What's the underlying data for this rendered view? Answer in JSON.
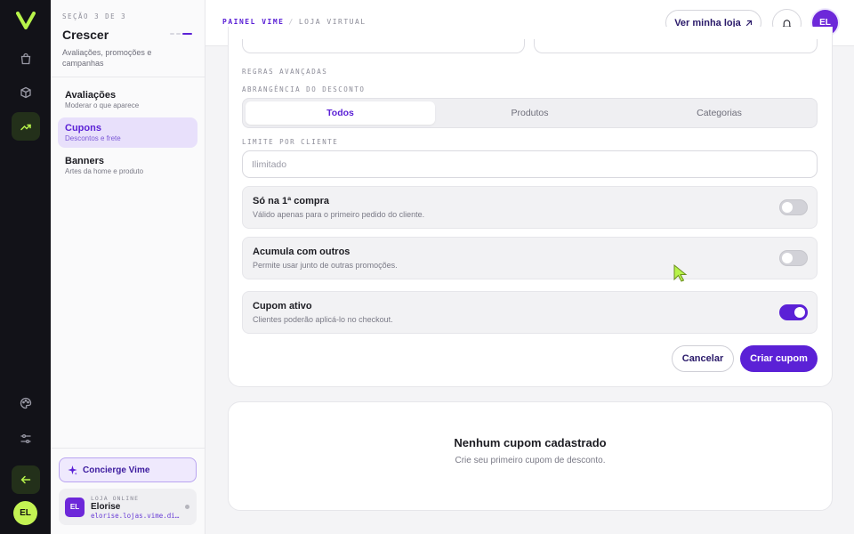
{
  "rail": {
    "avatar": "EL",
    "colors": {
      "bg": "#121218",
      "accent": "#b7f34a"
    }
  },
  "sidebar": {
    "step": "SEÇÃO 3 DE 3",
    "title": "Crescer",
    "description": "Avaliações, promoções e campanhas",
    "items": [
      {
        "label": "Avaliações",
        "sub": "Moderar o que aparece"
      },
      {
        "label": "Cupons",
        "sub": "Descontos e frete"
      },
      {
        "label": "Banners",
        "sub": "Artes da home e produto"
      }
    ],
    "concierge": "Concierge Vime",
    "store": {
      "avatar": "EL",
      "meta": "LOJA ONLINE",
      "name": "Elorise",
      "url": "elorise.lojas.vime.di…"
    }
  },
  "topbar": {
    "crumb_primary": "PAINEL VIME",
    "crumb_separator": "/",
    "crumb_secondary": "LOJA VIRTUAL",
    "view_store": "Ver minha loja",
    "avatar": "EL"
  },
  "form": {
    "advanced_rules": "REGRAS AVANÇADAS",
    "scope_label": "ABRANGÊNCIA DO DESCONTO",
    "scope_options": [
      "Todos",
      "Produtos",
      "Categorias"
    ],
    "limit_label": "LIMITE POR CLIENTE",
    "limit_placeholder": "Ilimitado",
    "toggles": [
      {
        "title": "Só na 1ª compra",
        "sub": "Válido apenas para o primeiro pedido do cliente.",
        "on": false
      },
      {
        "title": "Acumula com outros",
        "sub": "Permite usar junto de outras promoções.",
        "on": false
      },
      {
        "title": "Cupom ativo",
        "sub": "Clientes poderão aplicá-lo no checkout.",
        "on": true
      }
    ],
    "cancel": "Cancelar",
    "create": "Criar cupom"
  },
  "empty": {
    "title": "Nenhum cupom cadastrado",
    "sub": "Crie seu primeiro cupom de desconto."
  },
  "colors": {
    "primary": "#5b21d6",
    "lime": "#c3f253"
  }
}
